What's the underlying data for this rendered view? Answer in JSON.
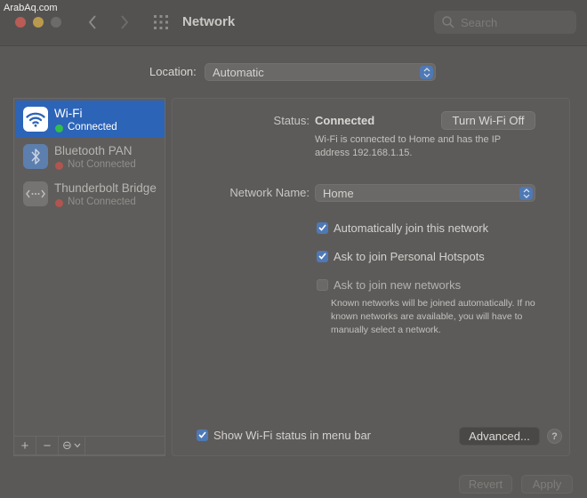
{
  "watermark": "ArabAq.com",
  "window": {
    "title": "Network"
  },
  "search": {
    "placeholder": "Search"
  },
  "location": {
    "label": "Location:",
    "value": "Automatic"
  },
  "services": [
    {
      "name": "Wi-Fi",
      "status": "Connected",
      "status_color": "#2fbf4a",
      "icon": "wifi-icon",
      "selected": true
    },
    {
      "name": "Bluetooth PAN",
      "status": "Not Connected",
      "status_color": "#c85a54",
      "icon": "bluetooth-icon",
      "selected": false
    },
    {
      "name": "Thunderbolt Bridge",
      "status": "Not Connected",
      "status_color": "#c85a54",
      "icon": "thunderbolt-bridge-icon",
      "selected": false
    }
  ],
  "sidebar_toolbar": {
    "add": "+",
    "remove": "−",
    "action": "⊖"
  },
  "detail": {
    "status_label": "Status:",
    "status_value": "Connected",
    "turn_off_button": "Turn Wi-Fi Off",
    "status_description": "Wi-Fi is connected to Home and has the IP address 192.168.1.15.",
    "network_name_label": "Network Name:",
    "network_name_value": "Home",
    "options": [
      {
        "label": "Automatically join this network",
        "checked": true
      },
      {
        "label": "Ask to join Personal Hotspots",
        "checked": true
      },
      {
        "label": "Ask to join new networks",
        "checked": false
      }
    ],
    "note": "Known networks will be joined automatically. If no known networks are available, you will have to manually select a network.",
    "show_status_label": "Show Wi-Fi status in menu bar",
    "show_status_checked": true,
    "advanced_button": "Advanced...",
    "help_button": "?"
  },
  "footer": {
    "revert_button": "Revert",
    "apply_button": "Apply"
  },
  "colors": {
    "accent": "#4e79b6",
    "selection": "#2c64b8"
  }
}
